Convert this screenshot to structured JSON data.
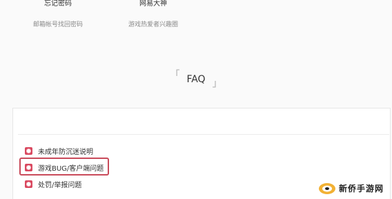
{
  "top_links": [
    {
      "title": "忘记密码",
      "subtitle": "邮箱帐号找回密码"
    },
    {
      "title": "网易大神",
      "subtitle": "游戏热爱者兴趣圈"
    }
  ],
  "faq": {
    "bracket_left": "「",
    "title": "FAQ",
    "bracket_right": "」"
  },
  "faq_items": [
    {
      "label": "未成年防沉迷说明"
    },
    {
      "label": "游戏BUG/客户端问题"
    },
    {
      "label": "处罚/举报问题"
    }
  ],
  "watermark": {
    "text": "新侨手游网"
  },
  "colors": {
    "accent": "#d9485f",
    "highlight": "#c94a5a"
  }
}
